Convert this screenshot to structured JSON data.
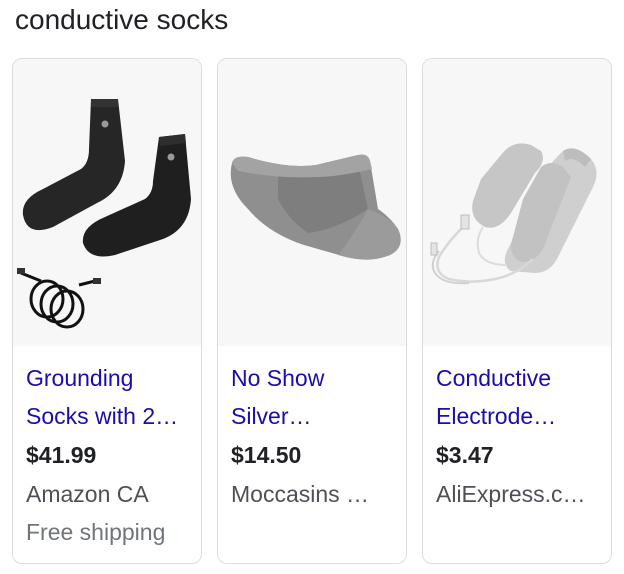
{
  "query": "conductive socks",
  "products": [
    {
      "title_line1": "Grounding",
      "title_line2": "Socks with 2…",
      "price": "$41.99",
      "merchant": "Amazon CA",
      "shipping": "Free shipping",
      "image_icon": "black-grounding-socks-with-cord-icon"
    },
    {
      "title_line1": "No Show",
      "title_line2": "Silver…",
      "price": "$14.50",
      "merchant": "Moccasins …",
      "shipping": "",
      "image_icon": "grey-no-show-sock-icon"
    },
    {
      "title_line1": "Conductive",
      "title_line2": "Electrode…",
      "price": "$3.47",
      "merchant": "AliExpress.c…",
      "shipping": "",
      "image_icon": "grey-electrode-socks-with-wire-icon"
    }
  ],
  "colors": {
    "link": "#1a0dab",
    "price": "#202124",
    "merchant": "#4d5156",
    "shipping": "#70757a",
    "card_border": "#dadce0"
  }
}
